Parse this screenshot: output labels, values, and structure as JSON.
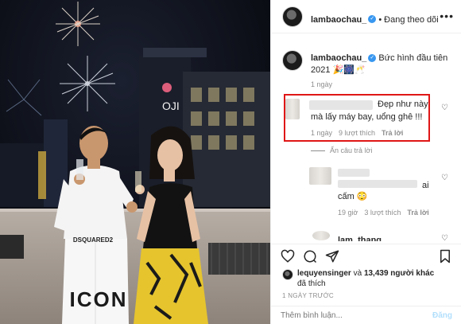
{
  "header": {
    "username": "lambaochau_",
    "verified_badge": "✓",
    "separator": "•",
    "follow_status": "Đang theo dõi",
    "more_icon": "•••"
  },
  "caption": {
    "username": "lambaochau_",
    "text": "Bức hình đầu tiên 2021 🎉🎆🥂",
    "time": "1 ngày"
  },
  "comments": [
    {
      "text_line1": "Đẹp như này",
      "text_line2": "mà lấy máy bay, uổng ghê !!!",
      "time": "1 ngày",
      "likes": "9 lượt thích",
      "reply": "Trả lời"
    }
  ],
  "hide_replies": "Ẩn câu trả lời",
  "reply_comment": {
    "text_suffix": "ai",
    "text_line2": "cấm 😳",
    "time": "19 giờ",
    "likes": "3 lượt thích",
    "reply": "Trả lời"
  },
  "partial_comment": {
    "username_partial": "lam_thanq..."
  },
  "likes": {
    "liker": "lequyensinger",
    "and": "và",
    "count": "13,439 người khác",
    "suffix": "đã thích"
  },
  "timestamp": "1 NGÀY TRƯỚC",
  "composer": {
    "placeholder": "Thêm bình luận...",
    "post_label": "Đăng"
  },
  "photo": {
    "shirt_text": "ICON",
    "brand_text": "DSQUARED2",
    "building_sign": "OJI"
  },
  "colors": {
    "highlight": "#e01616",
    "verified": "#3897f0",
    "post_disabled": "#b2dffc"
  }
}
